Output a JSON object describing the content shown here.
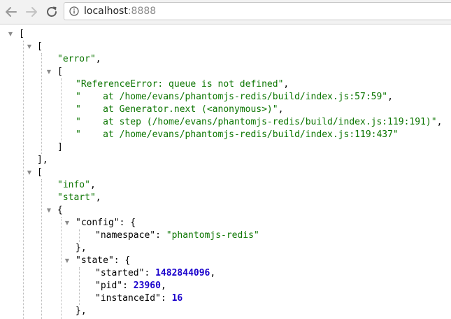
{
  "browser": {
    "url_host": "localhost",
    "url_port": ":8888"
  },
  "json": {
    "error_label": "\"error\"",
    "error_msg": "\"ReferenceError: queue is not defined\"",
    "stack_1": "\"    at /home/evans/phantomjs-redis/build/index.js:57:59\"",
    "stack_2": "\"    at Generator.next (<anonymous>)\"",
    "stack_3": "\"    at step (/home/evans/phantomjs-redis/build/index.js:119:191)\"",
    "stack_4": "\"    at /home/evans/phantomjs-redis/build/index.js:119:437\"",
    "info_label": "\"info\"",
    "start_label": "\"start\"",
    "config_key": "\"config\"",
    "namespace_key": "\"namespace\"",
    "namespace_val": "\"phantomjs-redis\"",
    "state_key": "\"state\"",
    "started_key": "\"started\"",
    "started_val": "1482844096",
    "pid_key": "\"pid\"",
    "pid_val": "23960",
    "instanceId_key": "\"instanceId\"",
    "instanceId_val": "16"
  }
}
